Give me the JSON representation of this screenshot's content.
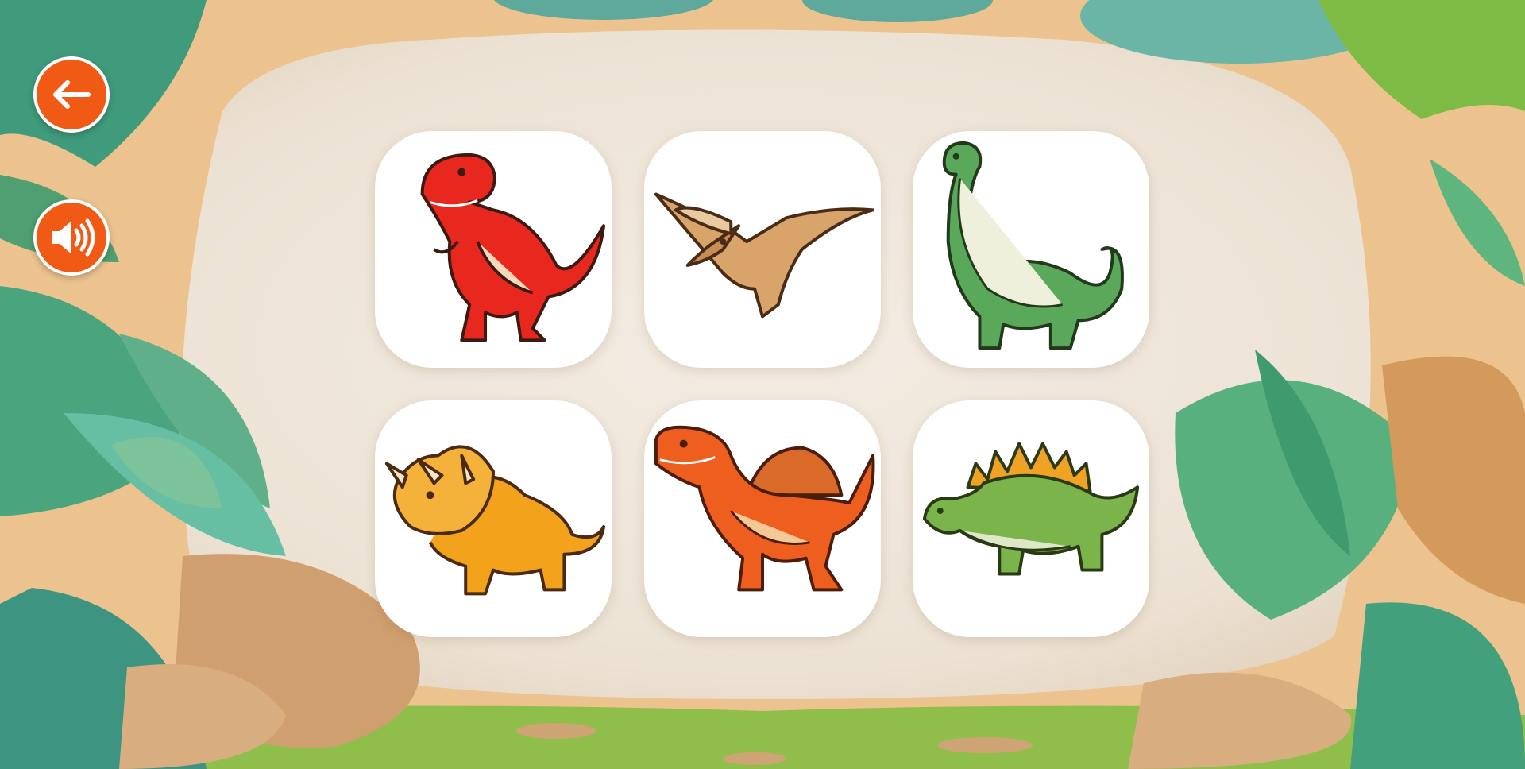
{
  "colors": {
    "button_bg": "#f05a14",
    "button_border": "#ffffff",
    "card_bg": "#ffffff",
    "backdrop": "#efe6da"
  },
  "controls": {
    "back": {
      "icon": "arrow-left-icon"
    },
    "sound": {
      "icon": "speaker-volume-icon"
    }
  },
  "cards": [
    {
      "id": "t-rex",
      "icon": "t-rex-icon",
      "color": "#e8281e"
    },
    {
      "id": "pterodactyl",
      "icon": "pterodactyl-icon",
      "color": "#d6a36a"
    },
    {
      "id": "brachiosaurus",
      "icon": "brachiosaurus-icon",
      "color": "#5aa85a"
    },
    {
      "id": "triceratops",
      "icon": "triceratops-icon",
      "color": "#f3a21c"
    },
    {
      "id": "spinosaurus",
      "icon": "spinosaurus-icon",
      "color": "#ee5f1f"
    },
    {
      "id": "stegosaurus",
      "icon": "stegosaurus-icon",
      "color": "#7ab44a"
    }
  ]
}
